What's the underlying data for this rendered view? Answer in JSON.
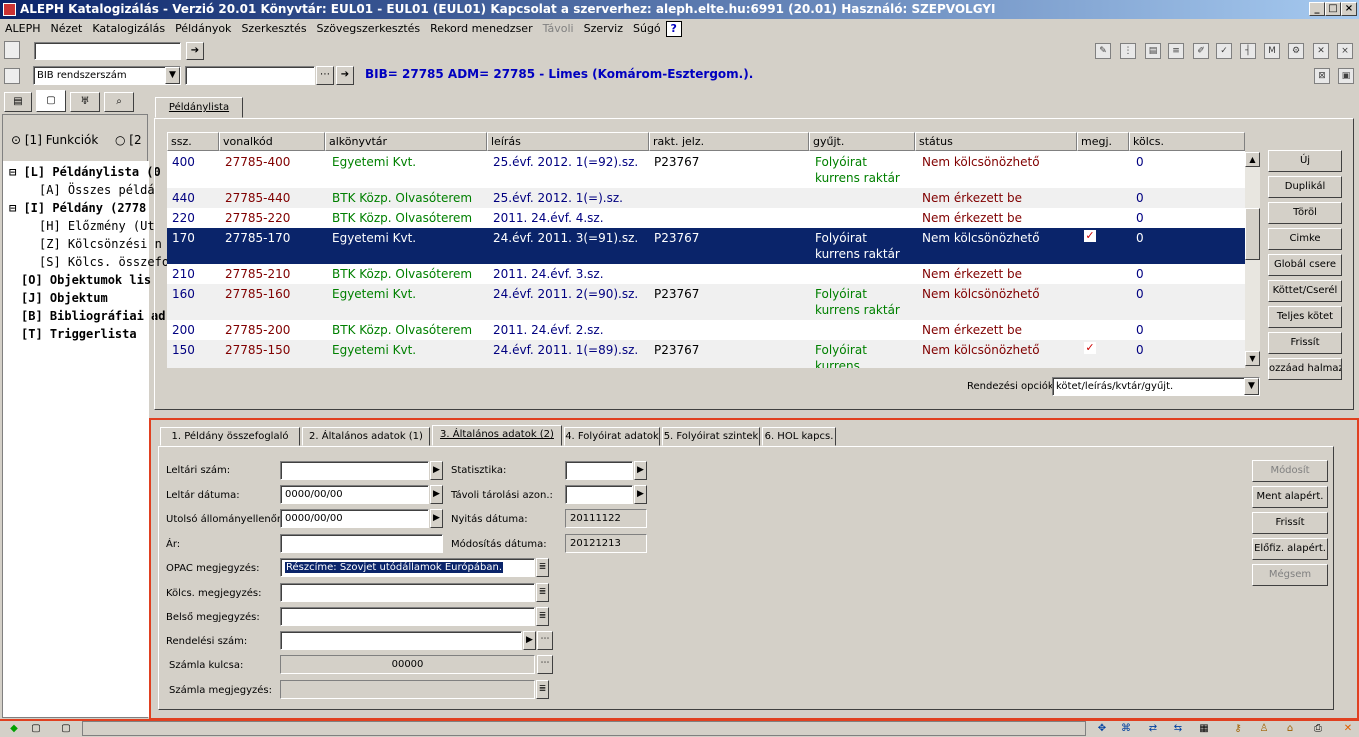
{
  "window": {
    "title": "ALEPH Katalogizálás - Verzió 20.01  Könyvtár:  EUL01 - EUL01 (EUL01)  Kapcsolat a szerverhez:  aleph.elte.hu:6991 (20.01)  Használó:  SZEPVOLGYI"
  },
  "menu": [
    "ALEPH",
    "Nézet",
    "Katalogizálás",
    "Példányok",
    "Szerkesztés",
    "Szövegszerkesztés",
    "Rekord menedzser",
    "Távoli",
    "Szerviz",
    "Súgó"
  ],
  "toolbar": {
    "combo_value": "BIB rendszerszám",
    "help_glyph": "?"
  },
  "bib_line": "BIB= 27785  ADM= 27785 - Limes (Komárom-Esztergom.).",
  "left": {
    "radio1": "[1] Funkciók",
    "radio2": "[2",
    "tree": [
      {
        "text": "[L] Példánylista (0",
        "bold": true
      },
      {
        "text": "[A] Összes példá",
        "bold": false
      },
      {
        "text": "[I] Példány (2778",
        "bold": true
      },
      {
        "text": "[H] Előzmény (Ut",
        "bold": false
      },
      {
        "text": "[Z] Kölcsönzési n",
        "bold": false
      },
      {
        "text": "[S] Kölcs. összefo",
        "bold": false
      },
      {
        "text": "[O] Objektumok lis",
        "bold": true
      },
      {
        "text": "[J] Objektum",
        "bold": true
      },
      {
        "text": "[B] Bibliográfiai ad",
        "bold": true
      },
      {
        "text": "[T] Triggerlista",
        "bold": true
      }
    ]
  },
  "list_tab": "Példánylista",
  "columns": [
    "ssz.",
    "vonalkód",
    "alkönyvtár",
    "leírás",
    "rakt. jelz.",
    "gyűjt.",
    "státus",
    "megj.",
    "kölcs."
  ],
  "rows": [
    {
      "ssz": "400",
      "barcode": "27785-400",
      "sub": "Egyetemi Kvt.",
      "desc": "25.évf. 2012. 1(=92).sz.",
      "shelf": "P23767",
      "coll": "Folyóirat kurrens raktár",
      "status": "Nem kölcsönözhető",
      "note": false,
      "loan": "0"
    },
    {
      "ssz": "440",
      "barcode": "27785-440",
      "sub": "BTK Közp. Olvasóterem",
      "desc": "25.évf. 2012. 1(=).sz.",
      "shelf": "",
      "coll": "",
      "status": "Nem érkezett be",
      "note": false,
      "loan": "0"
    },
    {
      "ssz": "220",
      "barcode": "27785-220",
      "sub": "BTK Közp. Olvasóterem",
      "desc": "2011. 24.évf. 4.sz.",
      "shelf": "",
      "coll": "",
      "status": "Nem érkezett be",
      "note": false,
      "loan": "0"
    },
    {
      "ssz": "170",
      "barcode": "27785-170",
      "sub": "Egyetemi Kvt.",
      "desc": "24.évf. 2011. 3(=91).sz.",
      "shelf": "P23767",
      "coll": "Folyóirat kurrens raktár",
      "status": "Nem kölcsönözhető",
      "note": true,
      "loan": "0"
    },
    {
      "ssz": "210",
      "barcode": "27785-210",
      "sub": "BTK Közp. Olvasóterem",
      "desc": "2011. 24.évf. 3.sz.",
      "shelf": "",
      "coll": "",
      "status": "Nem érkezett be",
      "note": false,
      "loan": "0"
    },
    {
      "ssz": "160",
      "barcode": "27785-160",
      "sub": "Egyetemi Kvt.",
      "desc": "24.évf. 2011. 2(=90).sz.",
      "shelf": "P23767",
      "coll": "Folyóirat kurrens raktár",
      "status": "Nem kölcsönözhető",
      "note": false,
      "loan": "0"
    },
    {
      "ssz": "200",
      "barcode": "27785-200",
      "sub": "BTK Közp. Olvasóterem",
      "desc": "2011. 24.évf. 2.sz.",
      "shelf": "",
      "coll": "",
      "status": "Nem érkezett be",
      "note": false,
      "loan": "0"
    },
    {
      "ssz": "150",
      "barcode": "27785-150",
      "sub": "Egyetemi Kvt.",
      "desc": "24.évf. 2011. 1(=89).sz.",
      "shelf": "P23767",
      "coll": "Folyóirat kurrens",
      "status": "Nem kölcsönözhető",
      "note": true,
      "loan": "0"
    }
  ],
  "right_buttons": [
    "Új",
    "Duplikál",
    "Töröl",
    "Cimke",
    "Globál csere",
    "Köttet/Cserél",
    "Teljes kötet",
    "Frissít",
    "ozzáad halmazho"
  ],
  "sort": {
    "label": "Rendezési opciók",
    "value": "kötet/leírás/kvtár/gyűjt."
  },
  "detail_tabs": [
    "1. Példány összefoglaló",
    "2. Általános adatok (1)",
    "3. Általános adatok (2)",
    "4. Folyóirat adatok",
    "5. Folyóirat szintek",
    "6. HOL kapcs."
  ],
  "form": {
    "leltari_szam": {
      "label": "Leltári szám:",
      "value": ""
    },
    "leltar_datuma": {
      "label": "Leltár dátuma:",
      "value": "0000/00/00"
    },
    "utolso": {
      "label": "Utolsó állományellenőrz",
      "value": "0000/00/00"
    },
    "ar": {
      "label": "Ár:",
      "value": ""
    },
    "opac": {
      "label": "OPAC megjegyzés:",
      "value": "Részcíme: Szovjet utódállamok Európában."
    },
    "kolcs": {
      "label": "Kölcs. megjegyzés:",
      "value": ""
    },
    "belso": {
      "label": "Belső megjegyzés:",
      "value": ""
    },
    "rendelesi": {
      "label": "Rendelési szám:",
      "value": ""
    },
    "szamla_kulcsa": {
      "label": "Számla kulcsa:",
      "value": "00000"
    },
    "szamla_megj": {
      "label": "Számla megjegyzés:",
      "value": ""
    },
    "statisztika": {
      "label": "Statisztika:",
      "value": ""
    },
    "tavoli": {
      "label": "Távoli tárolási azon.:",
      "value": ""
    },
    "nyitas": {
      "label": "Nyitás dátuma:",
      "value": "20111122"
    },
    "modositas": {
      "label": "Módosítás dátuma:",
      "value": "20121213"
    }
  },
  "panel_buttons": [
    {
      "label": "Módosít",
      "disabled": true
    },
    {
      "label": "Ment alapért.",
      "disabled": false
    },
    {
      "label": "Frissít",
      "disabled": false
    },
    {
      "label": "Előfiz. alapért.",
      "disabled": false
    },
    {
      "label": "Mégsem",
      "disabled": true
    }
  ]
}
